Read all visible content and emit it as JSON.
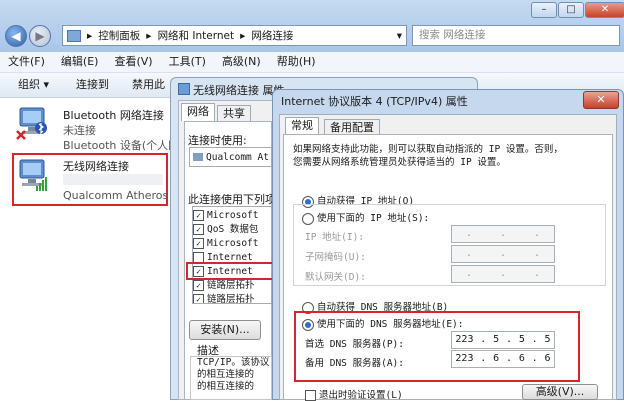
{
  "explorer": {
    "breadcrumb": [
      "控制面板",
      "网络和 Internet",
      "网络连接"
    ],
    "search_placeholder": "搜索 网络连接",
    "menu": [
      "文件(F)",
      "编辑(E)",
      "查看(V)",
      "工具(T)",
      "高级(N)",
      "帮助(H)"
    ],
    "toolbar": [
      "组织 ▾",
      "连接到",
      "禁用此"
    ],
    "connections": [
      {
        "name": "Bluetooth 网络连接",
        "status": "未连接",
        "device": "Bluetooth 设备(个人区"
      },
      {
        "name": "无线网络连接",
        "status": "",
        "device": "Qualcomm Atheros A"
      }
    ]
  },
  "dialog1": {
    "title": "无线网络连接 属性",
    "tabs": [
      "网络",
      "共享"
    ],
    "connect_using_label": "连接时使用:",
    "adapter": "Qualcomm At",
    "items_label": "此连接使用下列项",
    "items": [
      "Microsoft",
      "QoS 数据包",
      "Microsoft",
      "Internet",
      "Internet",
      "链路层拓扑",
      "链路层拓扑"
    ],
    "install_button": "安装(N)...",
    "desc_label": "描述",
    "desc_text": [
      "TCP/IP。该协议",
      "的相互连接的",
      "的相互连接的"
    ]
  },
  "dialog2": {
    "title": "Internet 协议版本 4 (TCP/IPv4) 属性",
    "close": "✕",
    "tabs": [
      "常规",
      "备用配置"
    ],
    "intro": [
      "如果网络支持此功能，则可以获取自动指派的 IP 设置。否则，",
      "您需要从网络系统管理员处获得适当的 IP 设置。"
    ],
    "auto_ip": "自动获得 IP 地址(O)",
    "manual_ip": "使用下面的 IP 地址(S):",
    "ip_label": "IP 地址(I):",
    "mask_label": "子网掩码(U):",
    "gateway_label": "默认网关(D):",
    "auto_dns": "自动获得 DNS 服务器地址(B)",
    "manual_dns": "使用下面的 DNS 服务器地址(E):",
    "preferred_dns_label": "首选 DNS 服务器(P):",
    "alternate_dns_label": "备用 DNS 服务器(A):",
    "preferred_dns": [
      "223",
      "5",
      "5",
      "5"
    ],
    "alternate_dns": [
      "223",
      "6",
      "6",
      "6"
    ],
    "validate_label": "退出时验证设置(L)",
    "advanced_button": "高级(V)..."
  }
}
